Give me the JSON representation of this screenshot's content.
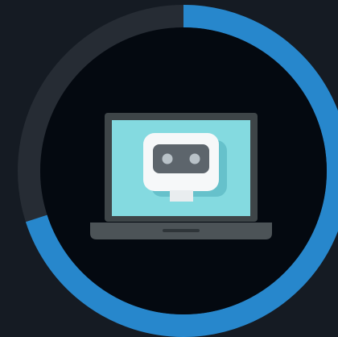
{
  "progress": {
    "value": 0.7
  },
  "colors": {
    "background": "#151b23",
    "ring_track": "#262c34",
    "ring_fill": "#2787cc",
    "inner_circle": "#040910",
    "laptop_frame": "#3e4548",
    "laptop_screen": "#84dae0",
    "laptop_base": "#4c5357",
    "trackpad": "#2f3539",
    "robot_body": "#f6f8f9",
    "robot_visor": "#5d656c",
    "robot_eyes": "#b9c2c8",
    "robot_shadow": "#66c1cb",
    "robot_neck": "#e9edef"
  },
  "icons": {
    "illustration": "laptop-robot-icon",
    "indicator": "circular-progress-ring"
  }
}
